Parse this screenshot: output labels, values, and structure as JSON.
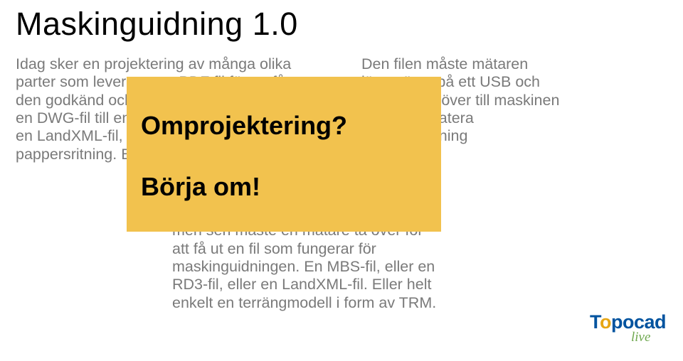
{
  "title": "Maskinguidning 1.0",
  "left_text": "Idag sker en projektering av många olika\nparter som levererar en PDF fil för att få\nden godkänd och kompletterar med\nen DWG-fil till entreprenören eller\nen LandXML-fil, eller helt enkelt bara en\npappersritning. Eller allt på en gång.",
  "right_text": "Den filen måste mätaren\nlägga över på ett USB och\nsen ta dem över till maskinen\nför att uppdatera\nmaskinguidning",
  "mid_text": "Entreprenören tar emot denna ritning\nmen sen måste en mätare ta över för\natt få ut en fil som fungerar för\nmaskinguidningen. En MBS-fil, eller en\nRD3-fil, eller en LandXML-fil. Eller helt\nenkelt en terrängmodell i form av TRM.",
  "callout": {
    "line1": "Omprojektering?",
    "line2": "Börja om!"
  },
  "logo": {
    "part1": "T",
    "part2": "o",
    "part3": "pocad",
    "sub": "live"
  }
}
